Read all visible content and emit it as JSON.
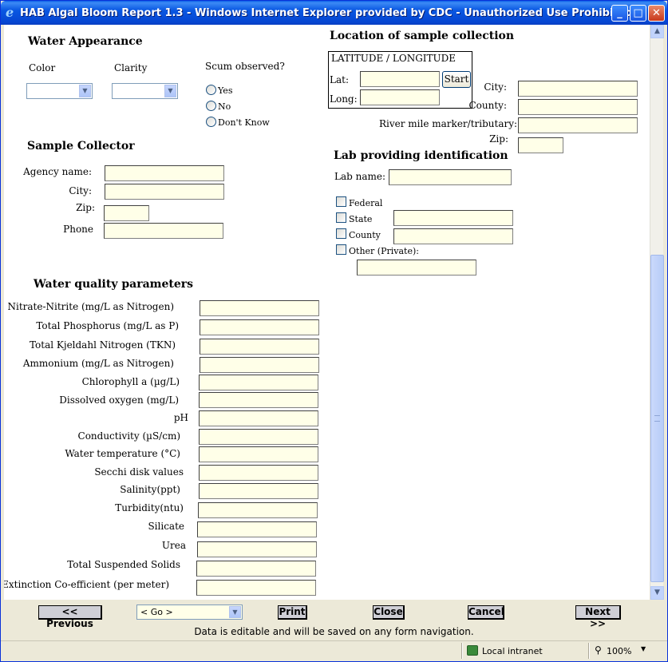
{
  "window": {
    "title": "HAB Algal Bloom Report 1.3 - Windows Internet Explorer provided by CDC - Unauthorized Use Prohibited",
    "icon": "ie-icon",
    "controls": {
      "minimize": "_",
      "maximize": "□",
      "close": "✕"
    }
  },
  "water_appearance": {
    "heading": "Water Appearance",
    "color_label": "Color",
    "color_value": "",
    "clarity_label": "Clarity",
    "clarity_value": "",
    "scum_label": "Scum observed?",
    "scum_options": [
      "Yes",
      "No",
      "Don't Know"
    ]
  },
  "location": {
    "heading": "Location of sample collection",
    "latlong_label": "LATITUDE / LONGITUDE",
    "lat_label": "Lat:",
    "long_label": "Long:",
    "start_button": "Start",
    "city_label": "City:",
    "county_label": "County:",
    "river_label": "River mile marker/tributary:",
    "zip_label": "Zip:"
  },
  "sample_collector": {
    "heading": "Sample Collector",
    "agency_label": "Agency name:",
    "city_label": "City:",
    "zip_label": "Zip:",
    "phone_label": "Phone"
  },
  "lab": {
    "heading": "Lab providing identification",
    "lab_name_label": "Lab name:",
    "options": [
      "Federal",
      "State",
      "County",
      "Other (Private):"
    ]
  },
  "water_quality": {
    "heading": "Water quality parameters",
    "params": [
      "Nitrate-Nitrite (mg/L as Nitrogen)",
      "Total Phosphorus (mg/L as P)",
      "Total Kjeldahl Nitrogen (TKN)",
      "Ammonium (mg/L as Nitrogen)",
      "Chlorophyll a (µg/L)",
      "Dissolved oxygen (mg/L)",
      "pH",
      "Conductivity (µS/cm)",
      "Water temperature (°C)",
      "Secchi disk values",
      "Salinity(ppt)",
      "Turbidity(ntu)",
      "Silicate",
      "Urea",
      "Total Suspended Solids",
      "Extinction Co-efficient (per meter)"
    ]
  },
  "navigation": {
    "previous": "<< Previous",
    "go_select": "< Go >",
    "print": "Print",
    "close": "Close",
    "cancel": "Cancel",
    "next": "Next >>",
    "message": "Data is editable and will be saved on any form navigation."
  },
  "status_bar": {
    "zone": "Local intranet",
    "zoom": "100%"
  }
}
